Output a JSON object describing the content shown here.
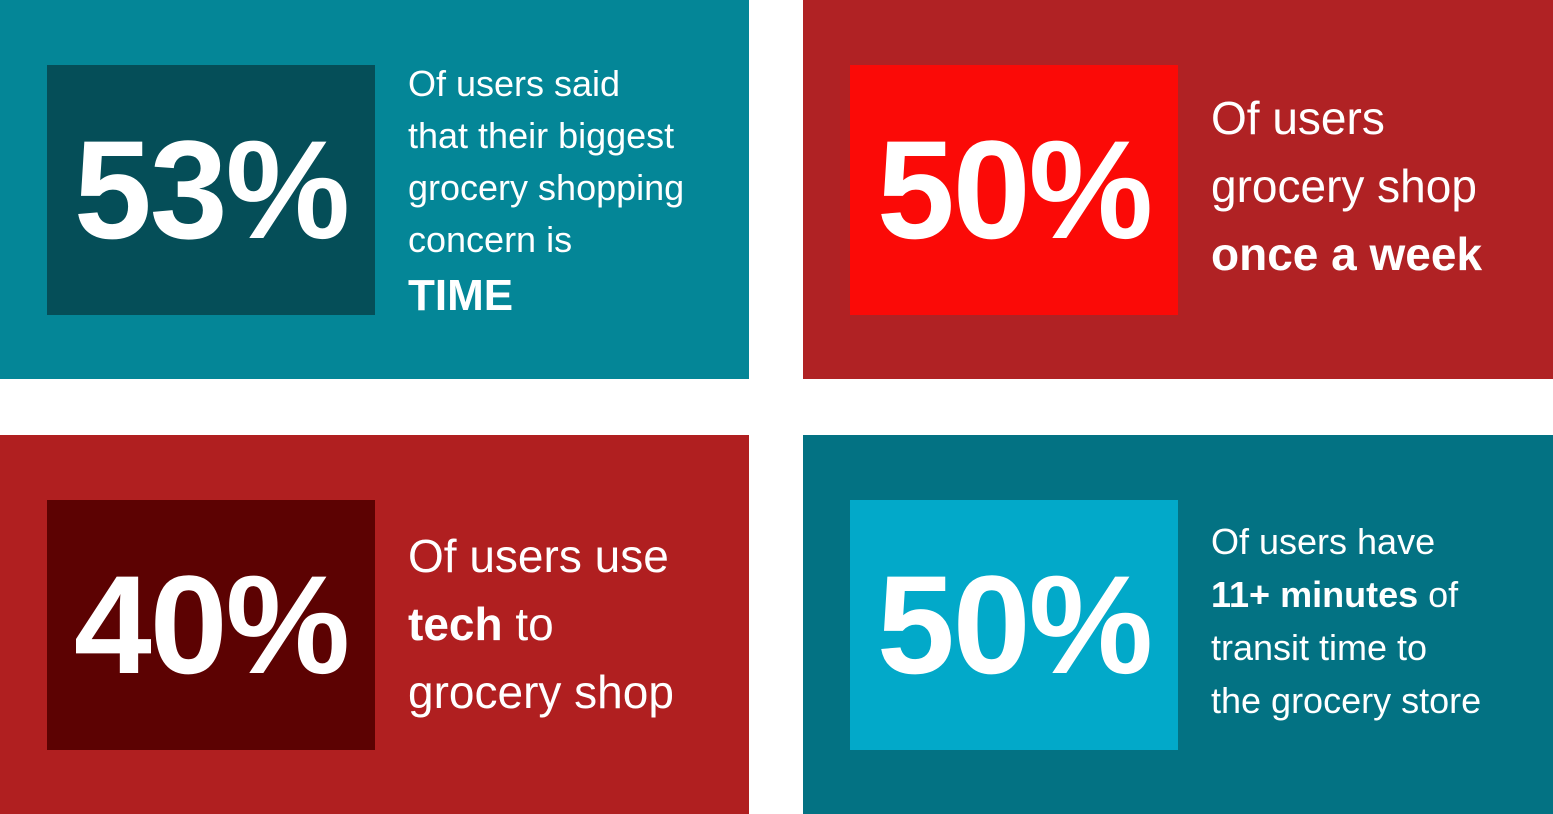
{
  "cards": [
    {
      "stat": "53%",
      "lines": [
        "Of users said",
        "that their biggest",
        "grocery shopping",
        "concern is"
      ],
      "emphasis": "TIME",
      "colors": {
        "panel": "#048697",
        "box": "#054e58"
      }
    },
    {
      "stat": "50%",
      "lines": [
        "Of users",
        "grocery shop"
      ],
      "emphasis": "once a week",
      "colors": {
        "panel": "#b02224",
        "box": "#fb0a07"
      }
    },
    {
      "stat": "40%",
      "line1": "Of users use",
      "bold_word": "tech",
      "after_bold": " to",
      "line3": "grocery shop",
      "colors": {
        "panel": "#b01f20",
        "box": "#5c0202"
      }
    },
    {
      "stat": "50%",
      "line1": "Of users have",
      "bold_phrase": "11+ minutes",
      "after_bold": " of",
      "line3": "transit time to",
      "line4": "the grocery store",
      "colors": {
        "panel": "#037283",
        "box": "#02a9c9"
      }
    }
  ]
}
